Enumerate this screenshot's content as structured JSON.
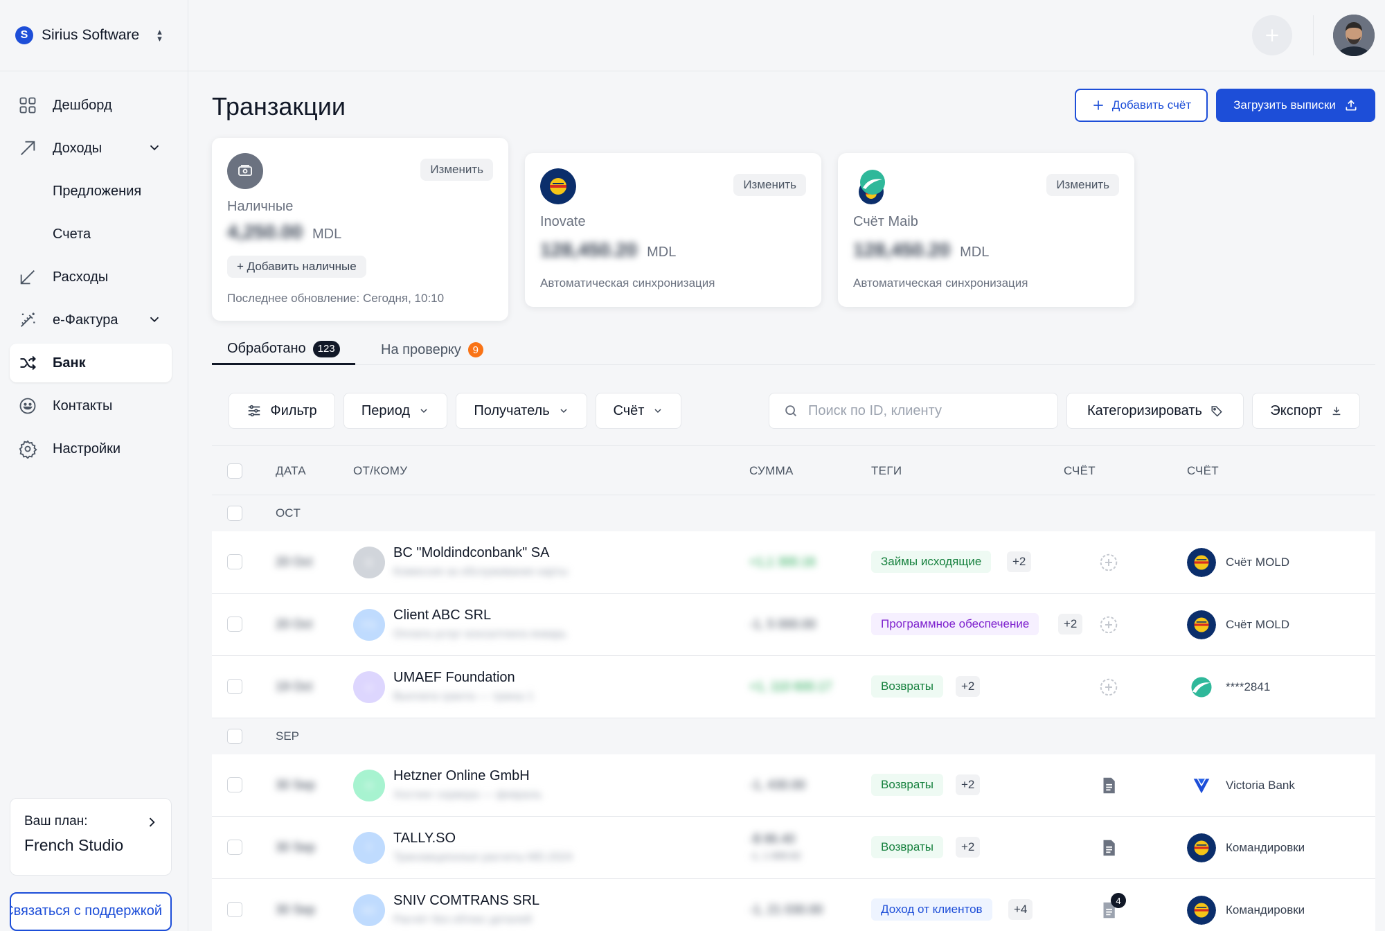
{
  "org": {
    "name": "Sirius Software",
    "logo_letter": "S"
  },
  "nav": [
    {
      "label": "Дешборд",
      "icon": "grid-icon"
    },
    {
      "label": "Доходы",
      "icon": "arrow-up-right-icon"
    },
    {
      "label": "Предложения"
    },
    {
      "label": "Счета"
    },
    {
      "label": "Расходы",
      "icon": "arrow-down-left-icon"
    },
    {
      "label": "e-Фактура",
      "icon": "magic-wand-icon"
    },
    {
      "label": "Банк",
      "icon": "shuffle-icon",
      "active": true
    },
    {
      "label": "Контакты",
      "icon": "smile-icon"
    },
    {
      "label": "Настройки",
      "icon": "gear-icon"
    }
  ],
  "plan": {
    "label": "Ваш план:",
    "name": "French Studio"
  },
  "support": {
    "label": "Связаться с поддержкой"
  },
  "header": {
    "title": "Транзакции",
    "add_account": "Добавить счёт",
    "upload": "Загрузить выписки"
  },
  "cards": [
    {
      "name": "Наличные",
      "balance": "4,250.00",
      "currency": "MDL",
      "edit": "Изменить",
      "add_cash": "+ Добавить наличные",
      "note": "Последнее обновление: Сегодня, 10:10"
    },
    {
      "name": "Inovate",
      "balance": "128,450.20",
      "currency": "MDL",
      "edit": "Изменить",
      "note": "Автоматическая синхронизация"
    },
    {
      "name": "Счёт Maib",
      "balance": "128,450.20",
      "currency": "MDL",
      "edit": "Изменить",
      "note": "Автоматическая синхронизация"
    }
  ],
  "tabs": [
    {
      "label": "Обработано",
      "count": "123"
    },
    {
      "label": "На проверку",
      "count": "9"
    }
  ],
  "filters": {
    "filter": "Фильтр",
    "period": "Период",
    "recipient": "Получатель",
    "account": "Счёт",
    "search_placeholder": "Поиск по ID, клиенту",
    "categorize": "Категоризировать",
    "export": "Экспорт"
  },
  "columns": {
    "date": "ДАТА",
    "party": "ОТ/КОМУ",
    "amount": "СУММА",
    "tags": "ТЕГИ",
    "receipt": "СЧЁТ",
    "account": "СЧЁТ"
  },
  "groups": [
    {
      "label": "OCT",
      "rows": [
        {
          "date": "20 Oct",
          "initials": "B",
          "name": "BC \"Moldindconbank\" SA",
          "sub": "Комиссия за обслуживание карты",
          "amount": "+1,1 300.16",
          "sign": "pos",
          "tag": "Займы исходящие",
          "tag_color": "green",
          "more": "+2",
          "account": "Счёт MOLD"
        },
        {
          "date": "20 Oct",
          "initials": "FS",
          "name": "Client ABC SRL",
          "sub": "Оплата услуг консалтинга январь",
          "amount": "-1, 5 000.00",
          "sign": "neg",
          "tag": "Программное обеспечение",
          "tag_color": "purple",
          "more": "+2",
          "account": "Счёт MOLD"
        },
        {
          "date": "19 Oct",
          "initials": "U",
          "name": "UMAEF Foundation",
          "sub": "Выплата гранта — транш 1",
          "amount": "+1, 110 600.17",
          "sign": "pos",
          "tag": "Возвраты",
          "tag_color": "green",
          "more": "+2",
          "account": "****2841"
        }
      ]
    },
    {
      "label": "SEP",
      "rows": [
        {
          "date": "30 Sep",
          "initials": "H",
          "name": "Hetzner Online GmbH",
          "sub": "Хостинг сервера — февраль",
          "amount": "-1, 430.00",
          "sign": "neg",
          "tag": "Возвраты",
          "tag_color": "green",
          "more": "+2",
          "account": "Victoria Bank"
        },
        {
          "date": "30 Sep",
          "initials": "T",
          "name": "TALLY.SO",
          "sub": "Транзакционные расчеты MD.2024",
          "amount": "-$ 86.40",
          "amount2": "-1, 1 669.62",
          "sign": "neg",
          "tag": "Возвраты",
          "tag_color": "green",
          "more": "+2",
          "account": "Командировки"
        },
        {
          "date": "30 Sep",
          "initials": "SC",
          "name": "SNIV COMTRANS SRL",
          "sub": "Расчёт без обтекс деталей",
          "amount": "-1, 21 030.00",
          "sign": "neg",
          "tag": "Доход от клиентов",
          "tag_color": "blue",
          "more": "+4",
          "account": "Командировки",
          "receipt_count": "4"
        }
      ]
    }
  ]
}
